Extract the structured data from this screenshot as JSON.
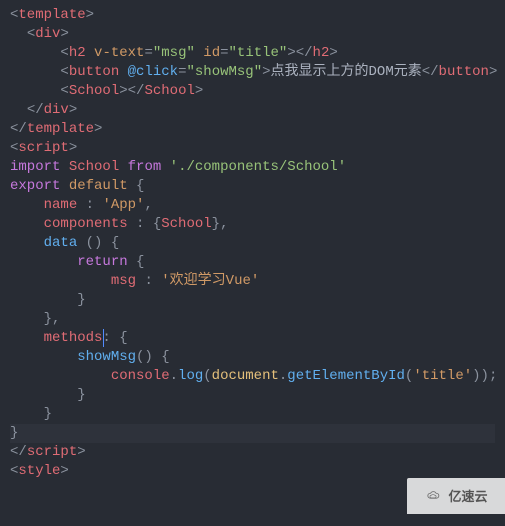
{
  "code": {
    "l1_p1": "<",
    "l1_tag": "template",
    "l1_p2": ">",
    "l2_indent": "  ",
    "l2_p1": "<",
    "l2_tag": "div",
    "l2_p2": ">",
    "l3_indent": "      ",
    "l3_p1": "<",
    "l3_tag": "h2",
    "l3_sp1": " ",
    "l3_attr1": "v-text",
    "l3_eq1": "=",
    "l3_val1": "\"msg\"",
    "l3_sp2": " ",
    "l3_attr2": "id",
    "l3_eq2": "=",
    "l3_val2": "\"title\"",
    "l3_p2": "></",
    "l3_tag2": "h2",
    "l3_p3": ">",
    "l4_indent": "      ",
    "l4_p1": "<",
    "l4_tag": "button",
    "l4_sp1": " ",
    "l4_evt": "@click",
    "l4_eq": "=",
    "l4_val": "\"showMsg\"",
    "l4_p2": ">",
    "l4_text": "点我显示上方的DOM元素",
    "l4_p3": "</",
    "l4_tag2": "button",
    "l4_p4": ">",
    "l5_indent": "      ",
    "l5_p1": "<",
    "l5_tag": "School",
    "l5_p2": "></",
    "l5_tag2": "School",
    "l5_p3": ">",
    "l6_indent": "  ",
    "l6_p1": "</",
    "l6_tag": "div",
    "l6_p2": ">",
    "l7_p1": "</",
    "l7_tag": "template",
    "l7_p2": ">",
    "l8": "",
    "l9": "",
    "l10_p1": "<",
    "l10_tag": "script",
    "l10_p2": ">",
    "l11_kw1": "import",
    "l11_sp1": " ",
    "l11_ident": "School",
    "l11_sp2": " ",
    "l11_kw2": "from",
    "l11_sp3": " ",
    "l11_str": "'./components/School'",
    "l12": "",
    "l13_kw1": "export",
    "l13_sp1": " ",
    "l13_kw2": "default",
    "l13_sp2": " ",
    "l13_brace": "{",
    "l14_indent": "    ",
    "l14_key": "name",
    "l14_sp": " : ",
    "l14_val": "'App'",
    "l14_comma": ",",
    "l15_indent": "    ",
    "l15_key": "components",
    "l15_sp": " : ",
    "l15_b1": "{",
    "l15_val": "School",
    "l15_b2": "}",
    "l15_comma": ",",
    "l16_indent": "    ",
    "l16_fn": "data",
    "l16_sp": " () ",
    "l16_brace": "{",
    "l17_indent": "        ",
    "l17_kw": "return",
    "l17_sp": " ",
    "l17_brace": "{",
    "l18_indent": "            ",
    "l18_key": "msg",
    "l18_sp": " : ",
    "l18_val": "'欢迎学习Vue'",
    "l19_indent": "        ",
    "l19_brace": "}",
    "l20_indent": "    ",
    "l20_brace": "}",
    "l20_comma": ",",
    "l21_indent": "    ",
    "l21_key": "methods",
    "l21_colon": ":",
    "l21_sp": " ",
    "l21_brace": "{",
    "l22_indent": "        ",
    "l22_fn": "showMsg",
    "l22_paren": "() ",
    "l22_brace": "{",
    "l23_indent": "            ",
    "l23_obj1": "console",
    "l23_dot1": ".",
    "l23_fn1": "log",
    "l23_p1": "(",
    "l23_obj2": "document",
    "l23_dot2": ".",
    "l23_fn2": "getElementById",
    "l23_p2": "(",
    "l23_str": "'title'",
    "l23_p3": "));",
    "l24_indent": "        ",
    "l24_brace": "}",
    "l25_indent": "    ",
    "l25_brace": "}",
    "l26_brace": "}",
    "l27_p1": "</",
    "l27_tag": "script",
    "l27_p2": ">",
    "l28": "",
    "l29_p1": "<",
    "l29_tag": "style",
    "l29_p2": ">"
  },
  "watermark": "亿速云"
}
